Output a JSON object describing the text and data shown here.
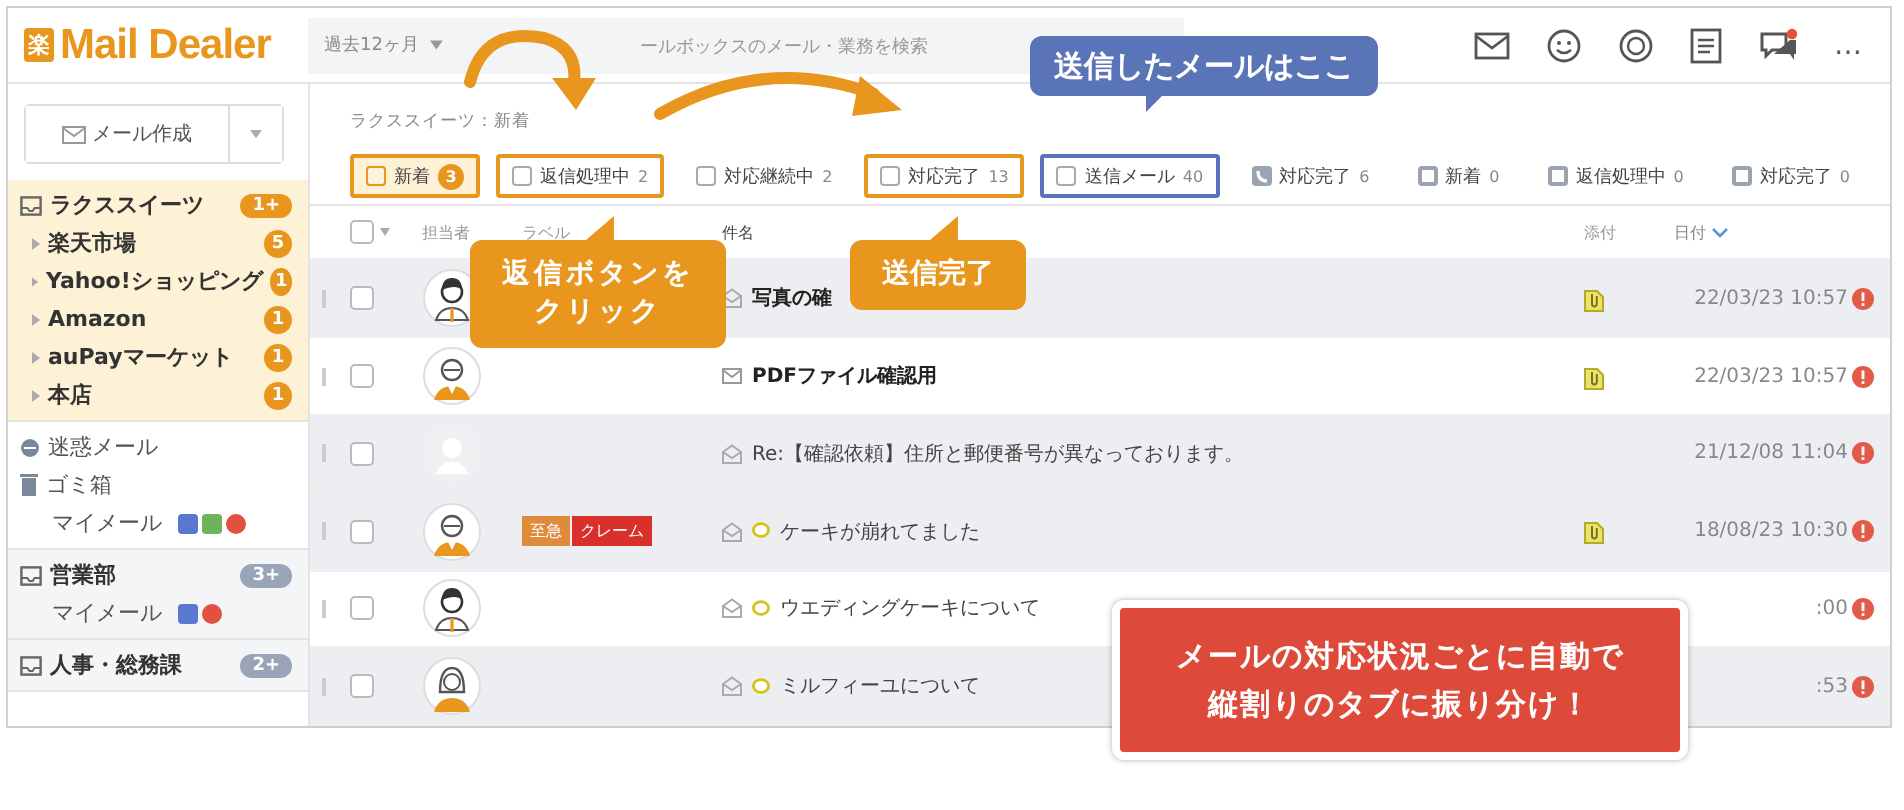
{
  "header": {
    "logo_mark": "楽",
    "logo": "Mail Dealer",
    "period": "過去12ヶ月",
    "search_placeholder": "ールボックスのメール・業務を検索",
    "more": "…"
  },
  "sidebar": {
    "compose": "メール作成",
    "groups": [
      {
        "name": "ラクススイーツ",
        "count": "1+",
        "selected": true,
        "children": [
          {
            "name": "楽天市場",
            "count": "5"
          },
          {
            "name": "Yahoo!ショッピング",
            "count": "1"
          },
          {
            "name": "Amazon",
            "count": "1"
          },
          {
            "name": "auPayマーケット",
            "count": "1"
          },
          {
            "name": "本店",
            "count": "1"
          }
        ]
      },
      {
        "kind": "folders",
        "items": [
          {
            "name": "迷惑メール",
            "kind": "spam"
          },
          {
            "name": "ゴミ箱",
            "kind": "trash"
          }
        ],
        "mymail": {
          "name": "マイメール",
          "marks": [
            {
              "color": "#5b78d0"
            },
            {
              "color": "#6cb35a"
            },
            {
              "color": "#e2513f"
            }
          ]
        }
      },
      {
        "name": "営業部",
        "count": "3+",
        "selected": false,
        "mymail": {
          "name": "マイメール",
          "marks": [
            {
              "color": "#5b78d0"
            },
            {
              "color": "#e2513f"
            }
          ]
        }
      },
      {
        "name": "人事・総務課",
        "count": "2+",
        "selected": false
      }
    ]
  },
  "main": {
    "breadcrumb": "ラクススイーツ：新着",
    "tabs": [
      {
        "label": "新着",
        "count": "3",
        "selected": true,
        "kind": "box",
        "color": "#e8961e"
      },
      {
        "label": "返信処理中",
        "count": "2",
        "selected": false,
        "kind": "box",
        "color": "#e8961e"
      },
      {
        "label": "対応継続中",
        "count": "2",
        "selected": false,
        "kind": "box"
      },
      {
        "label": "対応完了",
        "count": "13",
        "selected": false,
        "kind": "box",
        "color": "#e8961e"
      },
      {
        "label": "送信メール",
        "count": "40",
        "selected": false,
        "kind": "box",
        "color": "#5a74b8"
      },
      {
        "label": "対応完了",
        "count": "6",
        "selected": false,
        "kind": "phone"
      },
      {
        "label": "新着",
        "count": "0",
        "selected": false,
        "kind": "filled"
      },
      {
        "label": "返信処理中",
        "count": "0",
        "selected": false,
        "kind": "filled"
      },
      {
        "label": "対応完了",
        "count": "0",
        "selected": false,
        "kind": "filled"
      }
    ],
    "table": {
      "columns": [
        "担当者",
        "ラベル",
        "件名",
        "添付",
        "日付"
      ],
      "rows": [
        {
          "kind": "male",
          "unread": false,
          "comment": false,
          "subject": "写真の確",
          "bold": true,
          "attachment": true,
          "date": "22/03/23 10:57",
          "alert": true,
          "shaded": true
        },
        {
          "kind": "glasses",
          "unread": true,
          "comment": false,
          "subject": "PDFファイル確認用",
          "bold": true,
          "attachment": true,
          "date": "22/03/23 10:57",
          "alert": true,
          "shaded": false
        },
        {
          "kind": "blank",
          "unread": false,
          "comment": false,
          "subject": "Re:【確認依頼】住所と郵便番号が異なっております。",
          "bold": false,
          "attachment": false,
          "date": "21/12/08 11:04",
          "alert": true,
          "shaded": true
        },
        {
          "kind": "glasses",
          "labels": [
            {
              "text": "至急",
              "color": "#e08a3c"
            },
            {
              "text": "クレーム",
              "color": "#d9302b"
            }
          ],
          "unread": false,
          "comment": true,
          "subject": "ケーキが崩れてました",
          "bold": false,
          "attachment": true,
          "date": "18/08/23 10:30",
          "alert": true,
          "shaded": true
        },
        {
          "kind": "male",
          "unread": false,
          "comment": true,
          "subject": "ウエディングケーキについて",
          "bold": false,
          "attachment": false,
          "date": ":00",
          "alert": true,
          "shaded": false
        },
        {
          "kind": "female",
          "unread": false,
          "comment": true,
          "subject": "ミルフィーユについて",
          "bold": false,
          "attachment": false,
          "date": ":53",
          "alert": true,
          "shaded": true
        }
      ]
    }
  },
  "callouts": [
    {
      "kind": "blue",
      "lines": [
        "送信したメールはここ"
      ]
    },
    {
      "kind": "orange",
      "lines": [
        "返信ボタンを",
        "クリック"
      ]
    },
    {
      "kind": "orange-small",
      "lines": [
        "送信完了"
      ]
    },
    {
      "kind": "red",
      "lines": [
        "メールの対応状況ごとに自動で",
        "縦割りのタブに振り分け！"
      ]
    }
  ]
}
